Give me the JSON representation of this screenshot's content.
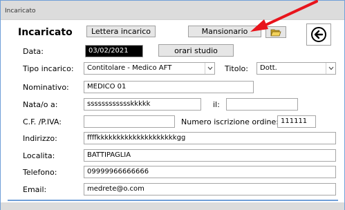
{
  "window": {
    "title": "Incaricato"
  },
  "header": {
    "title": "Incaricato",
    "lettera_label": "Lettera incarico",
    "mansionario_label": "Mansionario",
    "folder_icon": "folder-open-icon",
    "back_icon": "circle-arrow-left-icon"
  },
  "form": {
    "data_label": "Data:",
    "data_value": "03/02/2021",
    "orari_label": "orari studio",
    "tipo_label": "Tipo incarico:",
    "tipo_value": "Contitolare - Medico AFT",
    "titolo_label": "Titolo:",
    "titolo_value": "Dott.",
    "nominativo_label": "Nominativo:",
    "nominativo_value": "MEDICO 01",
    "nata_label": "Nata/o a:",
    "nata_value": "sssssssssssskkkkk",
    "il_label": "il:",
    "il_value": "",
    "cf_label": "C.F. /P.IVA:",
    "cf_value": "",
    "iscrizione_label": "Numero iscrizione ordine:",
    "iscrizione_value": "111111",
    "indirizzo_label": "Indirizzo:",
    "indirizzo_value": "ffffkkkkkkkkkkkkkkkkkkkkgg",
    "localita_label": "Localita:",
    "localita_value": "BATTIPAGLIA",
    "telefono_label": "Telefono:",
    "telefono_value": "09999966666666",
    "email_label": "Email:",
    "email_value": "medrete@o.com"
  },
  "colors": {
    "annotation_arrow": "#e8141c",
    "accent_border": "#6f9fd8"
  }
}
